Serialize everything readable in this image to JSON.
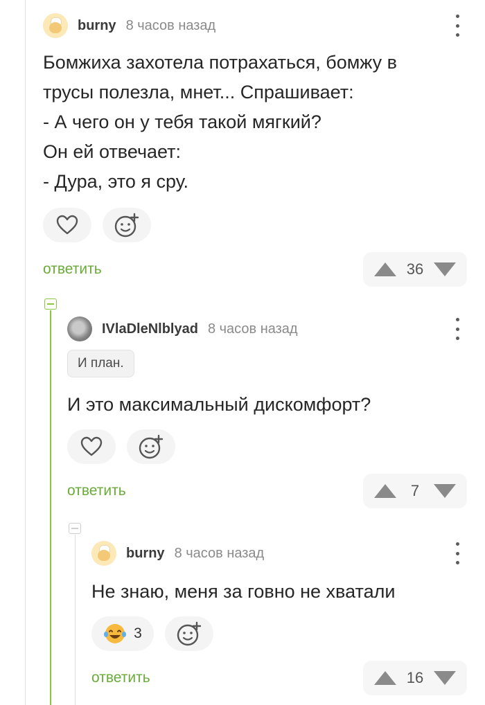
{
  "comments": [
    {
      "username": "burny",
      "timestamp": "8 часов назад",
      "text_lines": [
        "Бомжиха захотела потрахаться, бомжу в",
        "трусы полезла, мнет... Спрашивает:",
        "- А чего он у тебя такой мягкий?",
        "Он ей отвечает:",
        "- Дура, это я сру."
      ],
      "reply_label": "ответить",
      "rating": "36",
      "avatar_icon": "chef-avatar"
    },
    {
      "username": "IVlaDleNlblyad",
      "timestamp": "8 часов назад",
      "badge": "И план.",
      "text": "И это максимальный дискомфорт?",
      "reply_label": "ответить",
      "rating": "7",
      "avatar_icon": "photo-avatar"
    },
    {
      "username": "burny",
      "timestamp": "8 часов назад",
      "text": "Не знаю, меня за говно не хватали",
      "reaction": {
        "icon": "laughing-tears-emoji",
        "count": "3"
      },
      "reply_label": "ответить",
      "rating": "16",
      "avatar_icon": "chef-avatar"
    }
  ],
  "colors": {
    "accent_green": "#8cc63f",
    "reply_green": "#6aab38",
    "icon_gray": "#8a8a8a"
  }
}
